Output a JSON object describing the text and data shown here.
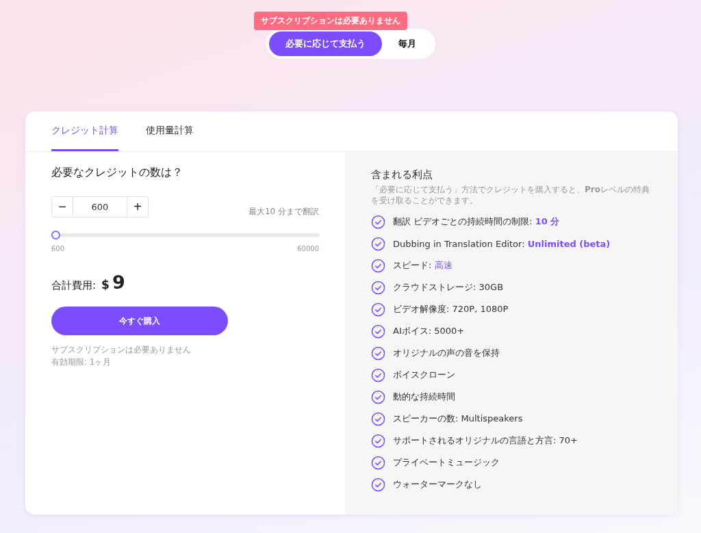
{
  "billing_toggle": {
    "tooltip": "サブスクリプションは必要ありません",
    "options": [
      {
        "label": "必要に応じて支払う",
        "selected": true
      },
      {
        "label": "毎月",
        "selected": false
      }
    ]
  },
  "tabs": [
    {
      "label": "クレジット計算",
      "selected": true
    },
    {
      "label": "使用量計算",
      "selected": false
    }
  ],
  "calculator": {
    "question": "必要なクレジットの数は？",
    "minus": "−",
    "quantity": "600",
    "plus": "+",
    "limit_note": "最大10 分まで翻訳",
    "slider": {
      "level": 0,
      "min_label": "600",
      "max_label": "60000"
    },
    "total_label": "合計費用:",
    "currency": "$",
    "total": "9",
    "buy_button": "今すぐ購入",
    "notes": [
      "サブスクリプションは必要ありません",
      "有効期限: 1ヶ月"
    ]
  },
  "benefits": {
    "title": "含まれる利点",
    "description": "「必要に応じて支払う」方法でクレジットを購入すると、**Pro**レベルの特典を受け取ることができます。",
    "items": [
      {
        "label": "翻訳 ビデオごとの持続時間の制限: ",
        "value": "10 分",
        "value_bold": true
      },
      {
        "label": "Dubbing in Translation Editor: ",
        "value": "Unlimited (beta)",
        "value_bold": true
      },
      {
        "label": "スピード: ",
        "value": "高速",
        "value_bold": false
      },
      {
        "label": "クラウドストレージ: 30GB"
      },
      {
        "label": "ビデオ解像度: 720P, 1080P"
      },
      {
        "label": "AIボイス: 5000+"
      },
      {
        "label": "オリジナルの声の音を保持"
      },
      {
        "label": "ボイスクローン"
      },
      {
        "label": "動的な持続時間"
      },
      {
        "label": "スピーカーの数: Multispeakers"
      },
      {
        "label": "サポートされるオリジナルの言語と方言: 70+"
      },
      {
        "label": "プライベートミュージック"
      },
      {
        "label": "ウォーターマークなし"
      }
    ]
  }
}
